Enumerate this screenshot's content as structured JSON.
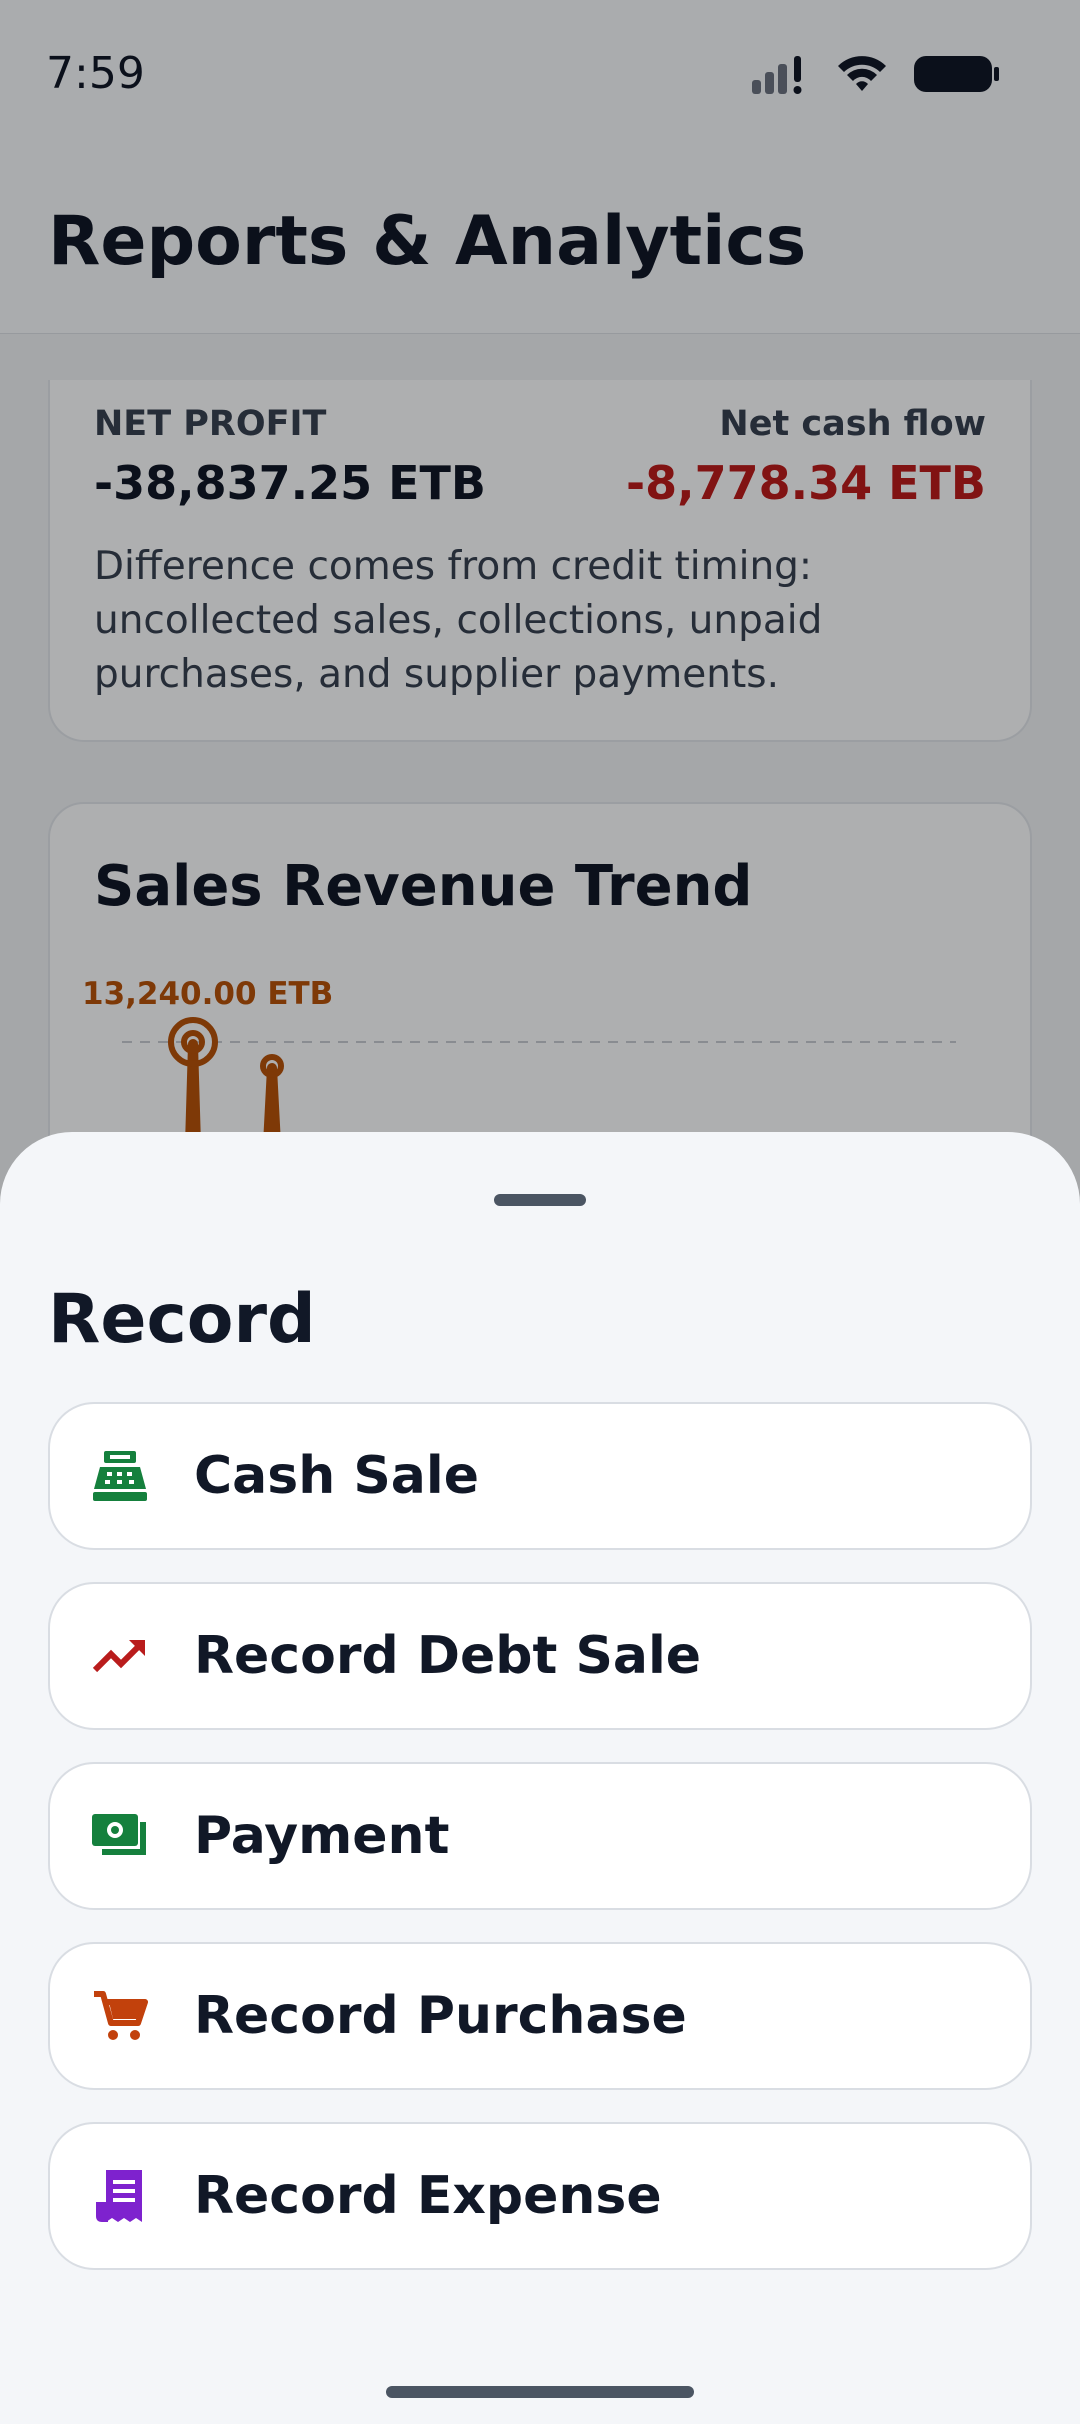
{
  "status_bar": {
    "time": "7:59"
  },
  "header": {
    "title": "Reports & Analytics"
  },
  "profit_card": {
    "net_profit_label": "NET PROFIT",
    "net_profit_value": "-38,837.25 ETB",
    "net_cash_flow_label": "Net cash flow",
    "net_cash_flow_value": "-8,778.34 ETB",
    "note": "Difference comes from credit timing: uncollected sales, collections, unpaid purchases, and supplier payments."
  },
  "trend_card": {
    "title": "Sales Revenue Trend"
  },
  "chart_data": {
    "type": "line",
    "title": "Sales Revenue Trend",
    "annotations": [
      "13,240.00 ETB"
    ],
    "series_color": "#b5520b"
  },
  "sheet": {
    "title": "Record",
    "actions": [
      {
        "label": "Cash Sale",
        "icon": "cash-register-icon",
        "color": "#15803d"
      },
      {
        "label": "Record Debt Sale",
        "icon": "trending-up-icon",
        "color": "#b91c1c"
      },
      {
        "label": "Payment",
        "icon": "money-icon",
        "color": "#15803d"
      },
      {
        "label": "Record Purchase",
        "icon": "cart-icon",
        "color": "#c2410c"
      },
      {
        "label": "Record Expense",
        "icon": "receipt-icon",
        "color": "#7e22ce"
      }
    ]
  },
  "colors": {
    "negative": "#b91c1c",
    "accent": "#b5520b"
  }
}
